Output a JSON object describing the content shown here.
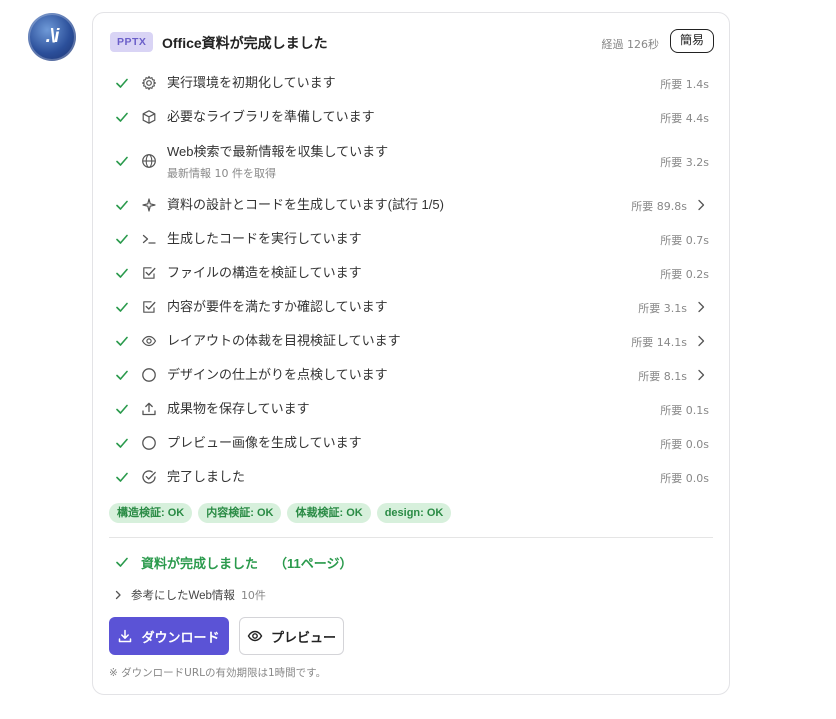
{
  "avatar": {
    "text": ".\\i"
  },
  "header": {
    "badge": "PPTX",
    "title": "Office資料が完成しました",
    "elapsed": "経過 126秒",
    "mode": "簡易"
  },
  "steps": [
    {
      "icon": "gear-icon",
      "label": "実行環境を初期化しています",
      "duration": "所要 1.4s",
      "expandable": false
    },
    {
      "icon": "package-icon",
      "label": "必要なライブラリを準備しています",
      "duration": "所要 4.4s",
      "expandable": false
    },
    {
      "icon": "globe-icon",
      "label": "Web検索で最新情報を収集しています",
      "sub": "最新情報 10 件を取得",
      "duration": "所要 3.2s",
      "expandable": false
    },
    {
      "icon": "sparkle-icon",
      "label": "資料の設計とコードを生成しています(試行 1/5)",
      "duration": "所要 89.8s",
      "expandable": true
    },
    {
      "icon": "terminal-icon",
      "label": "生成したコードを実行しています",
      "duration": "所要 0.7s",
      "expandable": false
    },
    {
      "icon": "checkbox-icon",
      "label": "ファイルの構造を検証しています",
      "duration": "所要 0.2s",
      "expandable": false
    },
    {
      "icon": "checkbox-icon",
      "label": "内容が要件を満たすか確認しています",
      "duration": "所要 3.1s",
      "expandable": true
    },
    {
      "icon": "eye-icon",
      "label": "レイアウトの体裁を目視検証しています",
      "duration": "所要 14.1s",
      "expandable": true
    },
    {
      "icon": "circle-icon",
      "label": "デザインの仕上がりを点検しています",
      "duration": "所要 8.1s",
      "expandable": true
    },
    {
      "icon": "upload-icon",
      "label": "成果物を保存しています",
      "duration": "所要 0.1s",
      "expandable": false
    },
    {
      "icon": "circle-icon",
      "label": "プレビュー画像を生成しています",
      "duration": "所要 0.0s",
      "expandable": false
    },
    {
      "icon": "check-circle-icon",
      "label": "完了しました",
      "duration": "所要 0.0s",
      "expandable": false
    }
  ],
  "tags": [
    "構造検証: OK",
    "内容検証: OK",
    "体裁検証: OK",
    "design: OK"
  ],
  "result": {
    "title": "資料が完成しました",
    "pages": "（11ページ）"
  },
  "references": {
    "label": "参考にしたWeb情報",
    "count": "10件"
  },
  "buttons": {
    "download": "ダウンロード",
    "preview": "プレビュー"
  },
  "note": "※ ダウンロードURLの有効期限は1時間です。",
  "colors": {
    "accent": "#5b53d6",
    "success": "#2a9a4c",
    "badge_bg": "#d9d4f5",
    "tag_bg": "#d7f0dc"
  }
}
